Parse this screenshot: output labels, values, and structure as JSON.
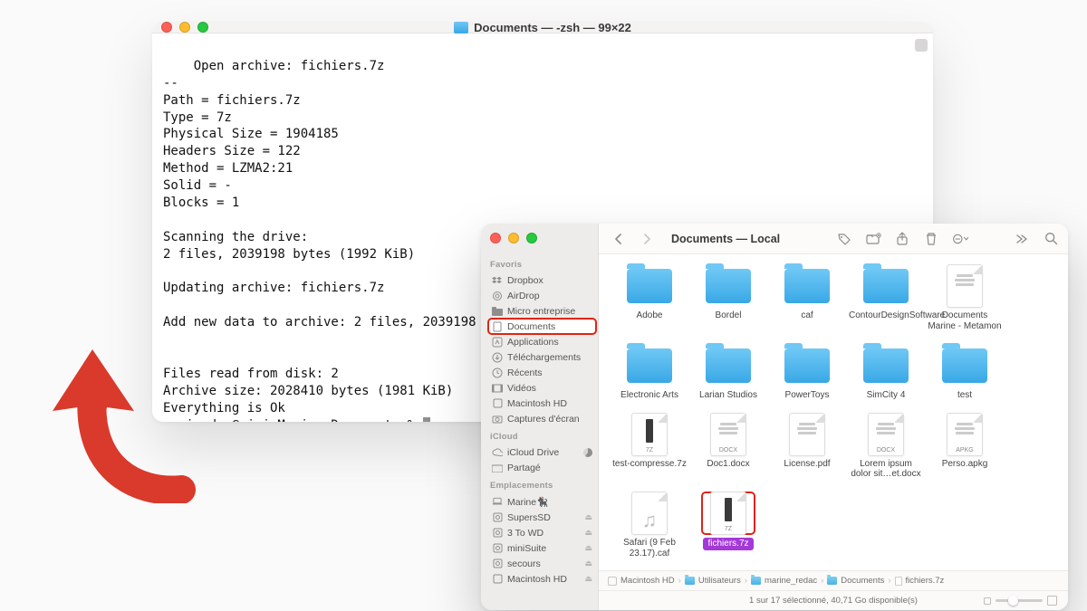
{
  "terminal": {
    "title_text": "Documents — -zsh — 99×22",
    "lines": [
      "Open archive: fichiers.7z",
      "--",
      "Path = fichiers.7z",
      "Type = 7z",
      "Physical Size = 1904185",
      "Headers Size = 122",
      "Method = LZMA2:21",
      "Solid = -",
      "Blocks = 1",
      "",
      "Scanning the drive:",
      "2 files, 2039198 bytes (1992 KiB)",
      "",
      "Updating archive: fichiers.7z",
      "",
      "Add new data to archive: 2 files, 2039198 ",
      "",
      "",
      "Files read from disk: 2",
      "Archive size: 2028410 bytes (1981 KiB)",
      "Everything is Ok"
    ],
    "prompt_prefix": "mari",
    "prompt_hidden": "ne_",
    "prompt_suffix": "redac@mini-Marine Documents % "
  },
  "finder": {
    "title": "Documents — Local",
    "sidebar": {
      "favoris_header": "Favoris",
      "favoris": [
        "Dropbox",
        "AirDrop",
        "Micro entreprise",
        "Documents",
        "Applications",
        "Téléchargements",
        "Récents",
        "Vidéos",
        "Macintosh HD",
        "Captures d'écran"
      ],
      "selected_favori_index": 3,
      "icloud_header": "iCloud",
      "icloud": [
        "iCloud Drive",
        "Partagé"
      ],
      "emplacements_header": "Emplacements",
      "emplacements": [
        "Marine🐈‍⬛",
        "SupersSD",
        "3 To WD",
        "miniSuite",
        "secours",
        "Macintosh HD"
      ]
    },
    "files": [
      {
        "name": "Adobe",
        "kind": "folder"
      },
      {
        "name": "Bordel",
        "kind": "folder"
      },
      {
        "name": "caf",
        "kind": "folder"
      },
      {
        "name": "ContourDesignSoftware",
        "kind": "folder"
      },
      {
        "name": "Documents Marine - Metamon",
        "kind": "doc",
        "ext": ""
      },
      {
        "name": "Electronic Arts",
        "kind": "folder"
      },
      {
        "name": "Larian Studios",
        "kind": "folder"
      },
      {
        "name": "PowerToys",
        "kind": "folder"
      },
      {
        "name": "SimCity 4",
        "kind": "folder"
      },
      {
        "name": "test",
        "kind": "folder"
      },
      {
        "name": "test-compresse.7z",
        "kind": "7z",
        "ext": "7Z"
      },
      {
        "name": "Doc1.docx",
        "kind": "doc",
        "ext": "DOCX"
      },
      {
        "name": "License.pdf",
        "kind": "doc",
        "ext": ""
      },
      {
        "name": "Lorem ipsum dolor sit…et.docx",
        "kind": "doc",
        "ext": "DOCX"
      },
      {
        "name": "Perso.apkg",
        "kind": "doc",
        "ext": "APKG"
      },
      {
        "name": "Safari (9 Feb 23.17).caf",
        "kind": "audio",
        "ext": ""
      },
      {
        "name": "fichiers.7z",
        "kind": "7z",
        "ext": "7Z",
        "selected": true
      }
    ],
    "path": [
      "Macintosh HD",
      "Utilisateurs",
      "marine_redac",
      "Documents",
      "fichiers.7z"
    ],
    "status": "1 sur 17 sélectionné, 40,71 Go disponible(s)"
  }
}
